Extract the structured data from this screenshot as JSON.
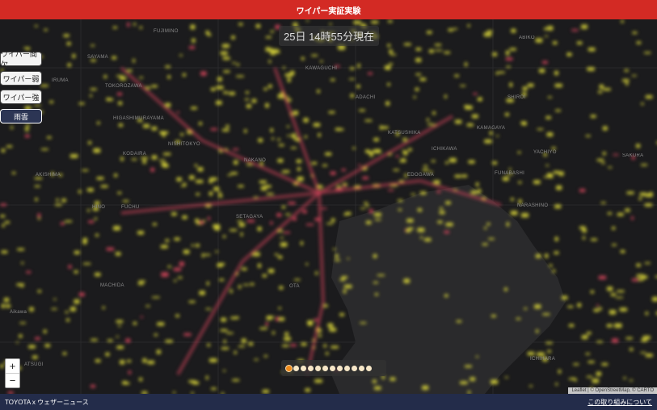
{
  "header": {
    "title": "ワイパー実証実験"
  },
  "timestamp": "25日 14時55分現在",
  "layers": [
    {
      "label": "ワイパー間欠",
      "active": false
    },
    {
      "label": "ワイパー弱",
      "active": false
    },
    {
      "label": "ワイパー強",
      "active": false
    },
    {
      "label": "雨雲",
      "active": true
    }
  ],
  "zoom": {
    "in_label": "+",
    "out_label": "−"
  },
  "timeline": {
    "steps": 12,
    "current_index": 0
  },
  "place_labels": [
    "FUJIMINO",
    "SAYAMA",
    "IRUMA",
    "TOKOROZAWA",
    "HIGASHIMURAYAMA",
    "KODAIRA",
    "AKISHIMA",
    "HINO",
    "FUCHU",
    "MACHIDA",
    "ATSUGI",
    "NISHITOKYO",
    "NAKANO",
    "SETAGAYA",
    "OTA",
    "KAWAGUCHI",
    "ADACHI",
    "KATSUSHIKA",
    "EDOGAWA",
    "ICHIKAWA",
    "FUNABASHI",
    "NARASHINO",
    "KAMAGAYA",
    "SHIROI",
    "ABIKO",
    "YACHIYO",
    "SAKURA",
    "ICHIHARA",
    "Aikawa"
  ],
  "attribution": "Leaflet | © OpenStreetMap, © CARTO",
  "footer": {
    "left": "TOYOTA x ウェザーニュース",
    "right": "この取り組みについて"
  },
  "colors": {
    "header": "#d32a24",
    "footer": "#232c4a",
    "rain_light": "#d6d13a",
    "rain_heavy": "#d2455a",
    "map_bg": "#1b1b1d",
    "sea": "#2a2a2c"
  }
}
